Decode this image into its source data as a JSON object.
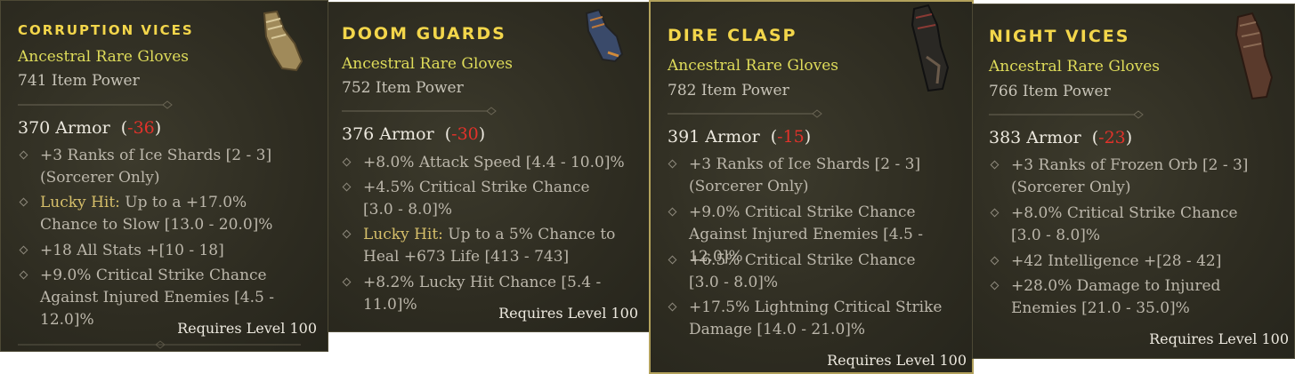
{
  "cards": [
    {
      "name": "CORRUPTION VICES",
      "type": "Ancestral Rare Gloves",
      "item_power": "741 Item Power",
      "armor": "370 Armor",
      "armor_diff": "-36",
      "affixes": [
        {
          "text": "+3 Ranks of Ice Shards [2 - 3] (Sorcerer Only)"
        },
        {
          "prefix": "Lucky Hit:",
          "text": " Up to a +17.0% Chance to Slow [13.0 - 20.0]%"
        },
        {
          "text": "+18 All Stats +[10 - 18]"
        },
        {
          "text": "+9.0% Critical Strike Chance Against Injured Enemies [4.5 - 12.0]%"
        }
      ],
      "requires": "Requires Level 100",
      "icon": "glove-icon-tan"
    },
    {
      "name": "DOOM GUARDS",
      "type": "Ancestral Rare Gloves",
      "item_power": "752 Item Power",
      "armor": "376 Armor",
      "armor_diff": "-30",
      "affixes": [
        {
          "text": "+8.0% Attack Speed [4.4 - 10.0]%"
        },
        {
          "text": "+4.5% Critical Strike Chance [3.0 - 8.0]%"
        },
        {
          "prefix": "Lucky Hit:",
          "text": " Up to a 5% Chance to Heal +673 Life [413 - 743]"
        },
        {
          "text": "+8.2% Lucky Hit Chance [5.4 - 11.0]%"
        }
      ],
      "requires": "Requires Level 100",
      "icon": "glove-icon-blue"
    },
    {
      "name": "DIRE CLASP",
      "type": "Ancestral Rare Gloves",
      "item_power": "782 Item Power",
      "armor": "391 Armor",
      "armor_diff": "-15",
      "affixes": [
        {
          "text": "+3 Ranks of Ice Shards [2 - 3] (Sorcerer Only)"
        },
        {
          "text": "+9.0% Critical Strike Chance Against Injured Enemies [4.5 - 12.0]%"
        },
        {
          "text": "+6.5% Critical Strike Chance [3.0 - 8.0]%"
        },
        {
          "text": "+17.5% Lightning Critical Strike Damage [14.0 - 21.0]%"
        }
      ],
      "requires": "Requires Level 100",
      "icon": "glove-icon-dark"
    },
    {
      "name": "NIGHT VICES",
      "type": "Ancestral Rare Gloves",
      "item_power": "766 Item Power",
      "armor": "383 Armor",
      "armor_diff": "-23",
      "affixes": [
        {
          "text": "+3 Ranks of Frozen Orb [2 - 3] (Sorcerer Only)"
        },
        {
          "text": "+8.0% Critical Strike Chance [3.0 - 8.0]%"
        },
        {
          "text": "+42 Intelligence +[28 - 42]"
        },
        {
          "text": "+28.0% Damage to Injured Enemies [21.0 - 35.0]%"
        }
      ],
      "requires": "Requires Level 100",
      "icon": "glove-icon-brown"
    }
  ],
  "colors": {
    "title": "#f3d64b",
    "rare": "#dfdc5a",
    "negative": "#e2322a",
    "lucky_hit": "#d6bf6a",
    "panel_bg": "#2e2c21"
  }
}
